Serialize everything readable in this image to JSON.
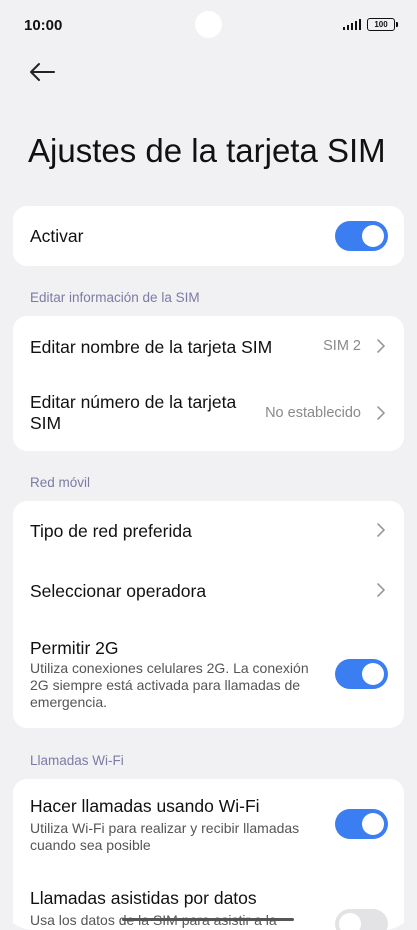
{
  "status_bar": {
    "time": "10:00",
    "battery": "100"
  },
  "header": {
    "title": "Ajustes de la tarjeta SIM"
  },
  "activate": {
    "label": "Activar",
    "enabled": true
  },
  "sections": {
    "edit_info": "Editar información de la SIM",
    "mobile_network": "Red móvil",
    "wifi_calls": "Llamadas Wi-Fi"
  },
  "edit_info": {
    "name": {
      "label": "Editar nombre de la tarjeta SIM",
      "value": "SIM 2"
    },
    "number": {
      "label": "Editar número de la tarjeta SIM",
      "value": "No establecido"
    }
  },
  "mobile_network": {
    "preferred": {
      "label": "Tipo de red preferida"
    },
    "operator": {
      "label": "Seleccionar operadora"
    },
    "allow_2g": {
      "label": "Permitir 2G",
      "description": "Utiliza conexiones celulares 2G. La conexión 2G siempre está activada para llamadas de emergencia.",
      "enabled": true
    }
  },
  "wifi_calls": {
    "wifi": {
      "label": "Hacer llamadas usando Wi-Fi",
      "description": "Utiliza Wi-Fi para realizar y recibir llamadas cuando sea posible",
      "enabled": true
    },
    "data_assisted": {
      "label": "Llamadas asistidas por datos",
      "description": "Usa los datos de la SIM para asistir a la",
      "enabled": false
    }
  },
  "colors": {
    "accent": "#3b7ef1",
    "background": "#f1f1f3",
    "card": "#ffffff",
    "section_header": "#7b7ba5"
  }
}
